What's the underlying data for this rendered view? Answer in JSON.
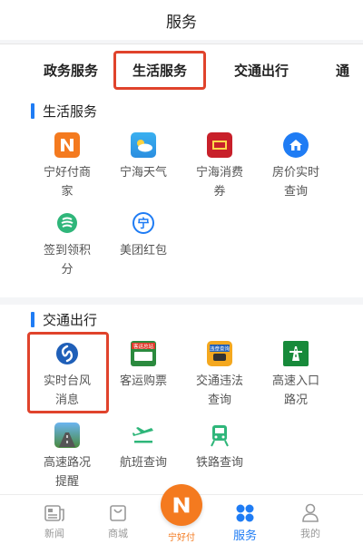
{
  "header": {
    "title": "服务"
  },
  "tabs": [
    {
      "label": "政务服务"
    },
    {
      "label": "生活服务"
    },
    {
      "label": "交通出行"
    },
    {
      "label": "通"
    }
  ],
  "sections": [
    {
      "title": "生活服务",
      "items": [
        {
          "name": "宁好付商家",
          "icon": "ninghaofu-merchant-icon"
        },
        {
          "name": "宁海天气",
          "icon": "weather-icon"
        },
        {
          "name": "宁海消费券",
          "icon": "consumer-voucher-icon"
        },
        {
          "name": "房价实时查询",
          "icon": "house-price-icon"
        },
        {
          "name": "签到领积分",
          "icon": "check-in-points-icon"
        },
        {
          "name": "美团红包",
          "icon": "meituan-red-packet-icon"
        }
      ]
    },
    {
      "title": "交通出行",
      "items": [
        {
          "name": "实时台风消息",
          "icon": "typhoon-icon"
        },
        {
          "name": "客运购票",
          "icon": "bus-ticket-icon",
          "badge": "客运总站"
        },
        {
          "name": "交通违法查询",
          "icon": "traffic-violation-icon",
          "badge": "违章查询"
        },
        {
          "name": "高速入口路况",
          "icon": "highway-entrance-icon"
        },
        {
          "name": "高速路况提醒",
          "icon": "highway-alert-icon"
        },
        {
          "name": "航班查询",
          "icon": "flight-icon"
        },
        {
          "name": "铁路查询",
          "icon": "railway-icon"
        }
      ]
    }
  ],
  "nav": [
    {
      "label": "新闻",
      "icon": "news-icon"
    },
    {
      "label": "商城",
      "icon": "shop-bag-icon"
    },
    {
      "label": "宁好付",
      "icon": "ninghaofu-logo-icon"
    },
    {
      "label": "服务",
      "icon": "services-grid-icon"
    },
    {
      "label": "我的",
      "icon": "profile-icon"
    }
  ],
  "colors": {
    "accent": "#1f7cf4",
    "highlight": "#e0432c",
    "brand_orange": "#f47a1f"
  }
}
